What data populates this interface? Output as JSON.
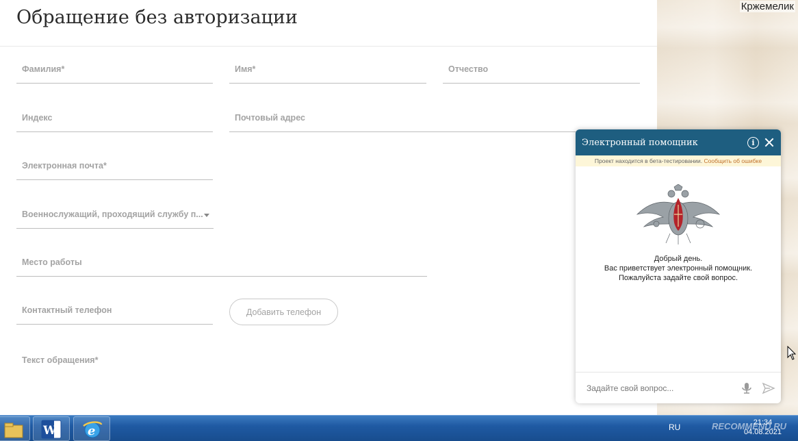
{
  "page": {
    "title": "Обращение без авторизации",
    "user_name": "Кржемелик"
  },
  "form": {
    "fields": {
      "last_name": "Фамилия*",
      "first_name": "Имя*",
      "patronymic": "Отчество",
      "postal_index": "Индекс",
      "postal_address": "Почтовый адрес",
      "email": "Электронная почта*",
      "category": "Военнослужащий, проходящий службу п...",
      "workplace": "Место работы",
      "phone": "Контактный телефон",
      "message": "Текст обращения*"
    },
    "add_phone_label": "Добавить телефон"
  },
  "chat": {
    "title": "Электронный помощник",
    "info_icon": "i",
    "beta_text": "Проект находится в бета-тестировании.",
    "beta_link": "Сообщить об ошибке",
    "greeting_line1": "Добрый день.",
    "greeting_line2": "Вас приветствует электронный помощник.",
    "greeting_line3": "Пожалуйста задайте свой вопрос.",
    "input_placeholder": "Задайте свой вопрос...",
    "header_color": "#1e5e80"
  },
  "taskbar": {
    "language": "RU",
    "time": "21:34",
    "date": "04.08.2021",
    "watermark": "RECOMMEND.RU",
    "apps": [
      "explorer-icon",
      "word-icon",
      "internet-explorer-icon"
    ]
  }
}
